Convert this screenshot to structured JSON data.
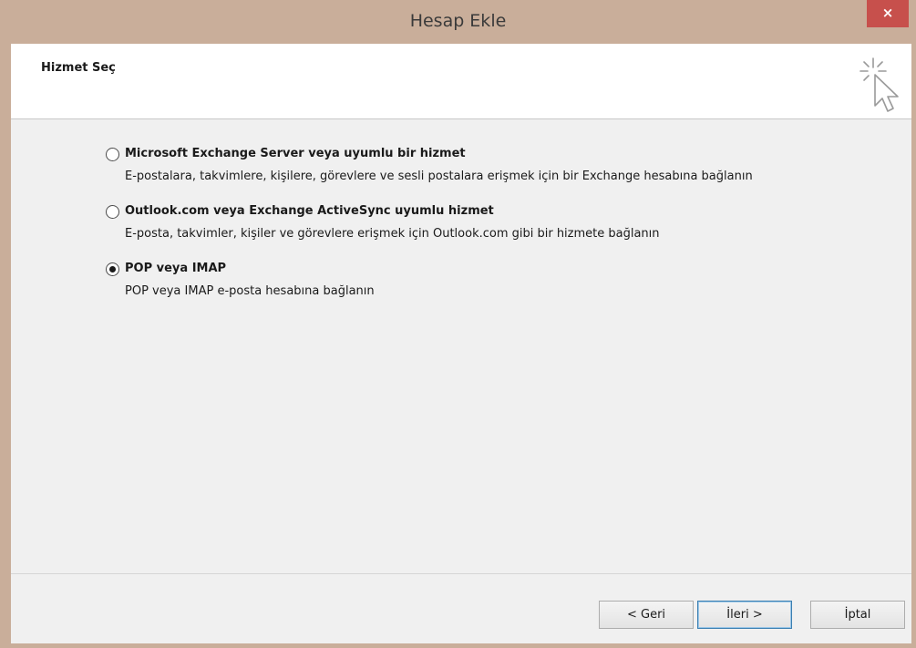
{
  "window": {
    "title": "Hesap Ekle",
    "close_glyph": "×"
  },
  "header": {
    "title": "Hizmet Seç"
  },
  "options": [
    {
      "label": "Microsoft Exchange Server veya uyumlu bir hizmet",
      "description": "E-postalara, takvimlere, kişilere, görevlere ve sesli postalara erişmek için bir Exchange hesabına bağlanın",
      "checked": false
    },
    {
      "label": "Outlook.com veya Exchange ActiveSync uyumlu hizmet",
      "description": "E-posta, takvimler, kişiler ve görevlere erişmek için Outlook.com gibi bir hizmete bağlanın",
      "checked": false
    },
    {
      "label": "POP veya IMAP",
      "description": "POP veya IMAP e-posta hesabına bağlanın",
      "checked": true
    }
  ],
  "buttons": {
    "back": "< Geri",
    "next": "İleri >",
    "cancel": "İptal"
  },
  "colors": {
    "titlebar": "#c9ae9a",
    "close": "#c7504c",
    "panel": "#f0f0f0"
  },
  "icons": {
    "header_icon": "wizard-cursor-icon"
  }
}
